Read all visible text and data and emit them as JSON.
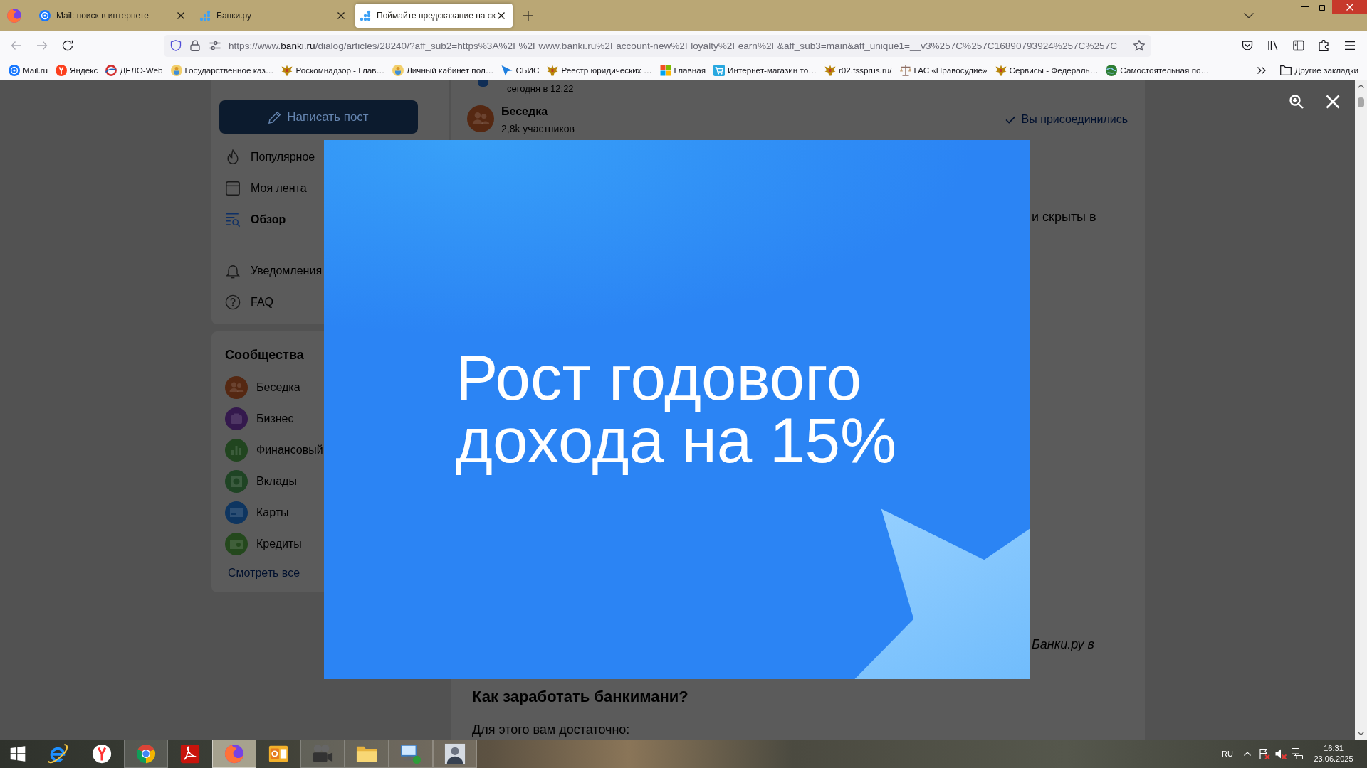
{
  "browser": {
    "tabs": [
      {
        "title": "Mail: поиск в интернете",
        "selected": false
      },
      {
        "title": "Банки.ру",
        "selected": false
      },
      {
        "title": "Поймайте предсказание на ск",
        "selected": true
      }
    ],
    "nav_buttons": [
      {
        "disabled": true
      },
      {
        "disabled": true
      },
      {
        "disabled": false
      }
    ],
    "address": {
      "prefix": "https://www.",
      "host": "banki.ru",
      "path": "/dialog/articles/28240/?aff_sub2=https%3A%2F%2Fwww.banki.ru%2Faccount-new%2Floyalty%2Fearn%2F&aff_sub3=main&aff_unique1=__v3%257C%257C16890793924%257C%257C"
    },
    "bookmarks": [
      "Mail.ru",
      "Яндекс",
      "ДЕЛО-Web",
      "Государственное каз…",
      "Роскомнадзор - Глав…",
      "Личный кабинет пол…",
      "СБИС",
      "Реестр юридических …",
      "Главная",
      "Интернет-магазин то…",
      "r02.fssprus.ru/",
      "ГАС «Правосудие»",
      "Сервисы - Федераль…",
      "Самостоятельная по…"
    ],
    "other_bookmarks": "Другие закладки"
  },
  "page": {
    "sidebar": {
      "compose_button": "Написать пост",
      "menu": [
        {
          "label": "Популярное",
          "selected": false
        },
        {
          "label": "Моя лента",
          "selected": false
        },
        {
          "label": "Обзор",
          "selected": true
        },
        {
          "label": "Уведомления",
          "selected": false
        },
        {
          "label": "FAQ",
          "selected": false
        }
      ]
    },
    "communities": {
      "title": "Сообщества",
      "items": [
        {
          "name": "Беседка",
          "color": "#552812"
        },
        {
          "name": "Бизнес",
          "color": "#34194d"
        },
        {
          "name": "Финансовый",
          "color": "#21451f"
        },
        {
          "name": "Вклады",
          "color": "#1f4424"
        },
        {
          "name": "Карты",
          "color": "#0e3560"
        },
        {
          "name": "Кредиты",
          "color": "#24481d"
        }
      ],
      "see_all": "Смотреть все"
    },
    "feed": {
      "previous_post_time": "сегодня в 12:22",
      "community_name": "Беседка",
      "members": "2,8k участников",
      "joined_label": "Вы присоединились",
      "text_fragment_top": "и скрыты в",
      "text_fragment_bottom": "Банки.ру в",
      "heading": "Как заработать банкимани?",
      "paragraph": "Для этого вам достаточно:"
    }
  },
  "story": {
    "headline": "Рост годового дохода на 15%"
  },
  "taskbar": {
    "apps": [
      {
        "running": false,
        "selected": false
      },
      {
        "running": false,
        "selected": false
      },
      {
        "running": true,
        "selected": false
      },
      {
        "running": false,
        "selected": false
      },
      {
        "running": true,
        "selected": true
      },
      {
        "running": false,
        "selected": false
      },
      {
        "running": true,
        "selected": false
      },
      {
        "running": true,
        "selected": false
      },
      {
        "running": true,
        "selected": false
      },
      {
        "running": true,
        "selected": false
      }
    ],
    "language": "RU",
    "time": "16:31",
    "date": "23.06.2025"
  }
}
